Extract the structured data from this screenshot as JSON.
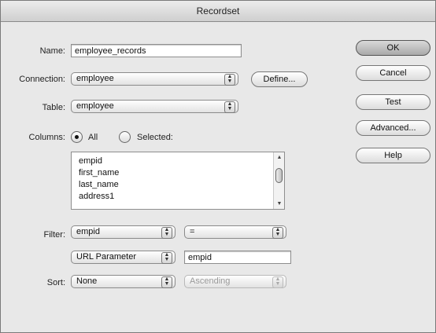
{
  "window": {
    "title": "Recordset"
  },
  "form": {
    "name_label": "Name:",
    "name_value": "employee_records",
    "connection_label": "Connection:",
    "connection_value": "employee",
    "define_label": "Define...",
    "table_label": "Table:",
    "table_value": "employee",
    "columns_label": "Columns:",
    "columns_all_label": "All",
    "columns_selected_label": "Selected:",
    "columns_selected_option": "All",
    "columns_list": [
      "empid",
      "first_name",
      "last_name",
      "address1"
    ],
    "filter_label": "Filter:",
    "filter_column": "empid",
    "filter_operator": "=",
    "filter_source": "URL Parameter",
    "filter_value": "empid",
    "sort_label": "Sort:",
    "sort_column": "None",
    "sort_order": "Ascending"
  },
  "buttons": {
    "ok": "OK",
    "cancel": "Cancel",
    "test": "Test",
    "advanced": "Advanced...",
    "help": "Help"
  }
}
